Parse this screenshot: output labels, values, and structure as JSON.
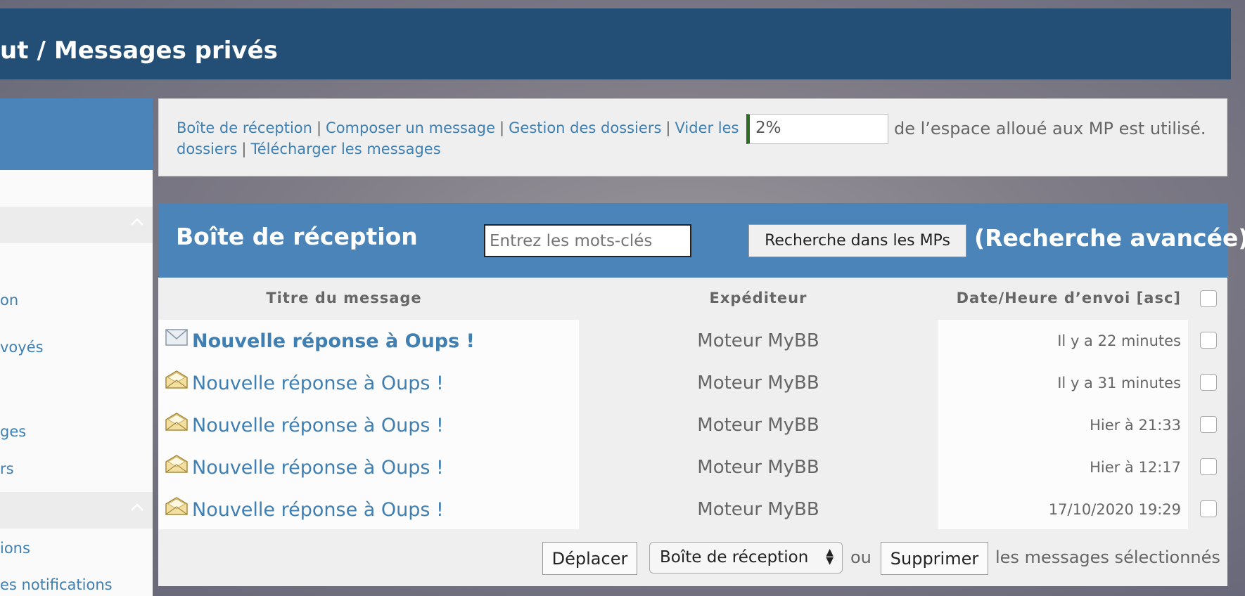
{
  "header": {
    "crumb_parent": "ut",
    "crumb_separator": "/",
    "crumb_current": "Messages privés"
  },
  "sidebar": {
    "items": [
      {
        "label": "on"
      },
      {
        "label": "voyés"
      },
      {
        "label": "ges"
      },
      {
        "label": "rs"
      },
      {
        "label": "ions"
      },
      {
        "label": "es notifications"
      }
    ]
  },
  "nav": {
    "links": [
      "Boîte de réception",
      "Composer un message",
      "Gestion des dossiers",
      "Vider les",
      "dossiers",
      "Télécharger les messages"
    ],
    "pipe": "|",
    "quota_value": "2%",
    "quota_fraction": 0.02,
    "quota_text": "de l’espace alloué aux MP est utilisé."
  },
  "main": {
    "title": "Boîte de réception",
    "search_placeholder": "Entrez les mots-clés",
    "search_button": "Recherche dans les MPs",
    "advanced_search": "(Recherche avancée)",
    "columns": {
      "title": "Titre du message",
      "sender": "Expéditeur",
      "date": "Date/Heure d’envoi [asc]"
    },
    "messages": [
      {
        "title": "Nouvelle réponse à Oups !",
        "sender": "Moteur MyBB",
        "date": "Il y a 22 minutes",
        "icon": "envelope-unread-icon"
      },
      {
        "title": "Nouvelle réponse à Oups !",
        "sender": "Moteur MyBB",
        "date": "Il y a 31 minutes",
        "icon": "envelope-read-icon"
      },
      {
        "title": "Nouvelle réponse à Oups !",
        "sender": "Moteur MyBB",
        "date": "Hier à 21:33",
        "icon": "envelope-read-icon"
      },
      {
        "title": "Nouvelle réponse à Oups !",
        "sender": "Moteur MyBB",
        "date": "Hier à 12:17",
        "icon": "envelope-read-icon"
      },
      {
        "title": "Nouvelle réponse à Oups !",
        "sender": "Moteur MyBB",
        "date": "17/10/2020 19:29",
        "icon": "envelope-read-icon"
      }
    ],
    "footer": {
      "move_button": "Déplacer",
      "folder_select": "Boîte de réception",
      "or_text": "ou",
      "delete_button": "Supprimer",
      "selected_text": "les messages sélectionnés"
    }
  },
  "colors": {
    "header_bg": "#234f77",
    "panel_head_bg": "#4a84b8",
    "link": "#3f7fb1",
    "quota_bar": "#2f6b24"
  }
}
